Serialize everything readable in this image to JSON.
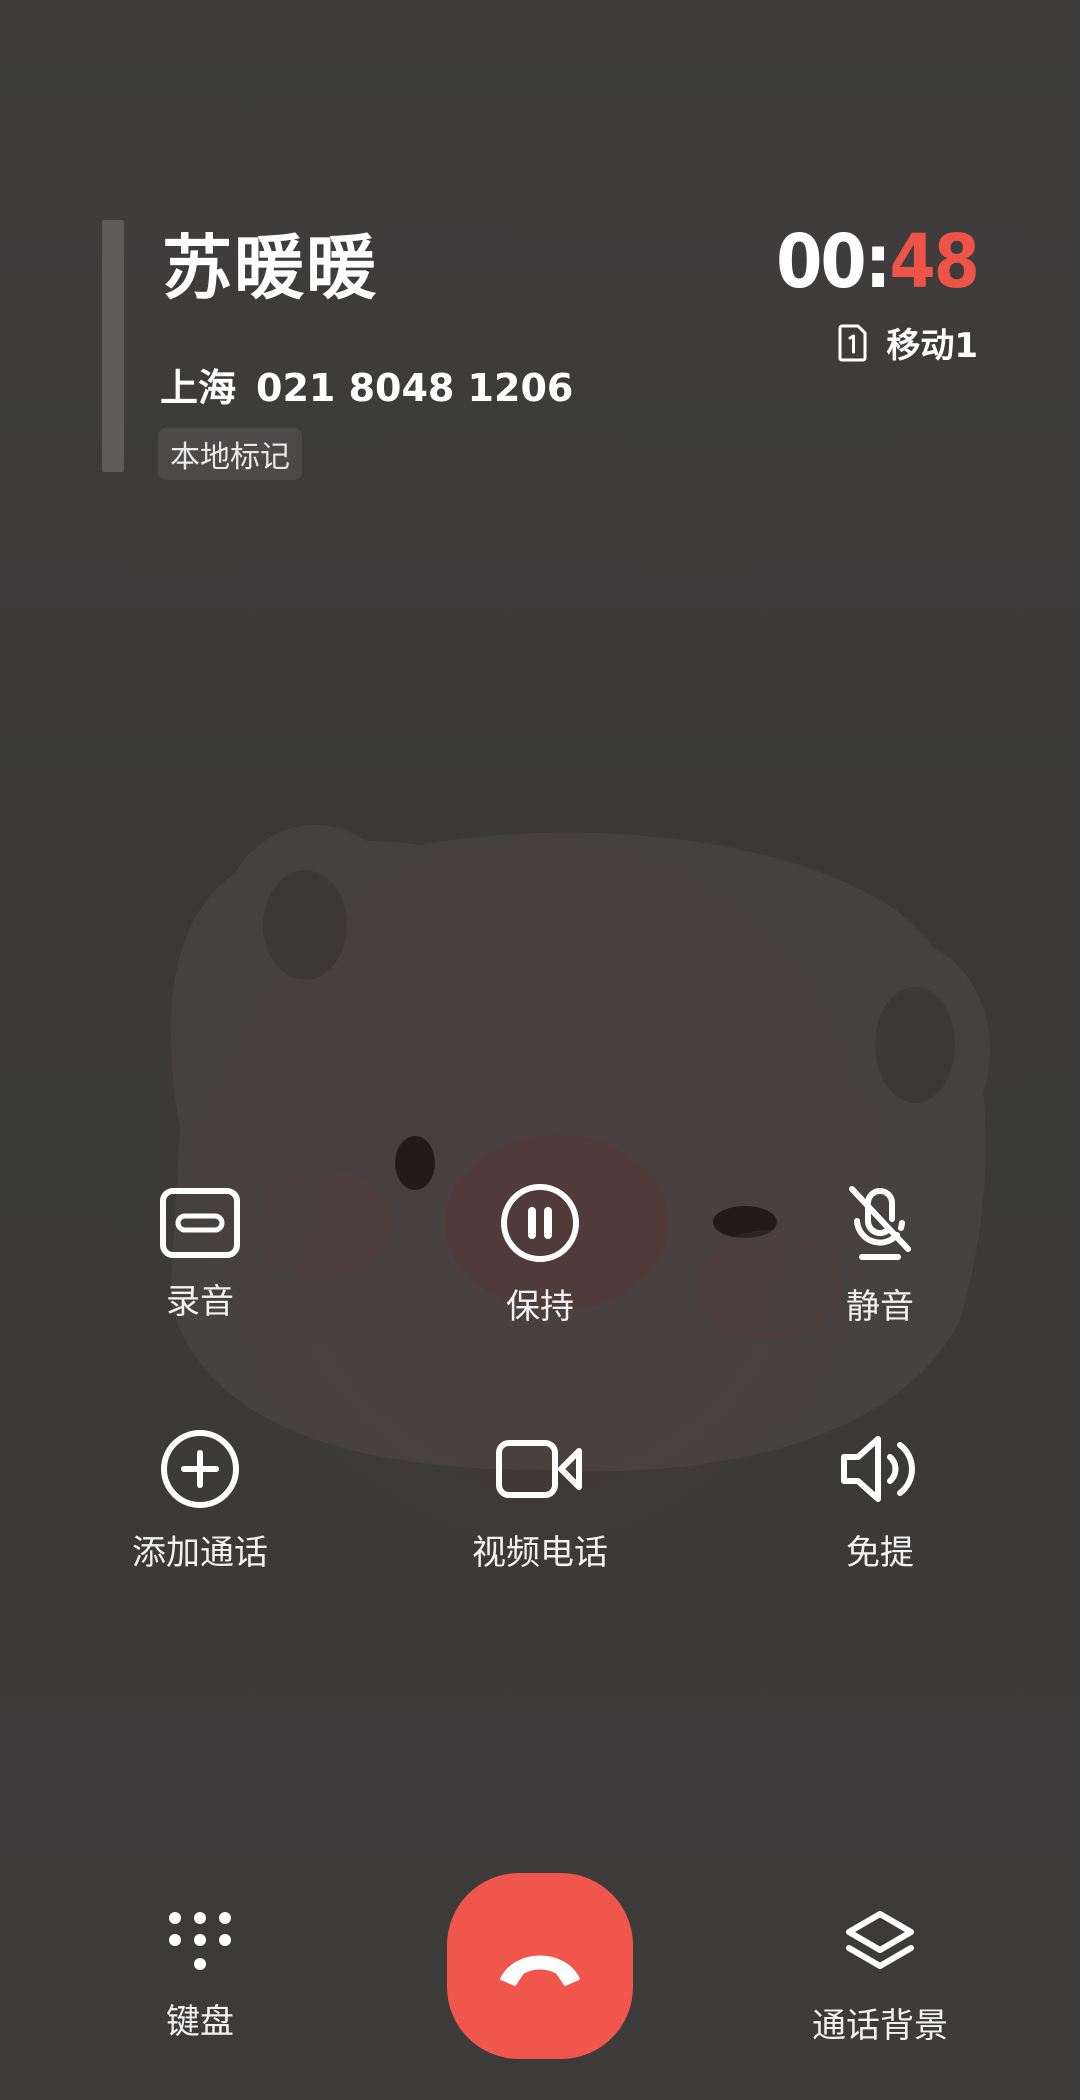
{
  "contact": {
    "name": "苏暖暖",
    "city": "上海",
    "number": "021 8048 1206",
    "tag": "本地标记"
  },
  "timer": {
    "minutes": "00:",
    "seconds": "48"
  },
  "sim": {
    "icon": "sim-1-icon",
    "carrier": "移动1"
  },
  "actions": [
    {
      "label": "录音",
      "icon": "record-icon"
    },
    {
      "label": "保持",
      "icon": "pause-icon"
    },
    {
      "label": "静音",
      "icon": "mic-off-icon"
    },
    {
      "label": "添加通话",
      "icon": "add-call-icon"
    },
    {
      "label": "视频电话",
      "icon": "video-icon"
    },
    {
      "label": "免提",
      "icon": "speaker-icon"
    }
  ],
  "bottom": {
    "keypad_label": "键盘",
    "background_label": "通话背景",
    "end_call_icon": "hang-up-icon"
  },
  "colors": {
    "background": "#3b3a39",
    "accent_red": "#ee5348",
    "end_call": "#f0564c"
  }
}
